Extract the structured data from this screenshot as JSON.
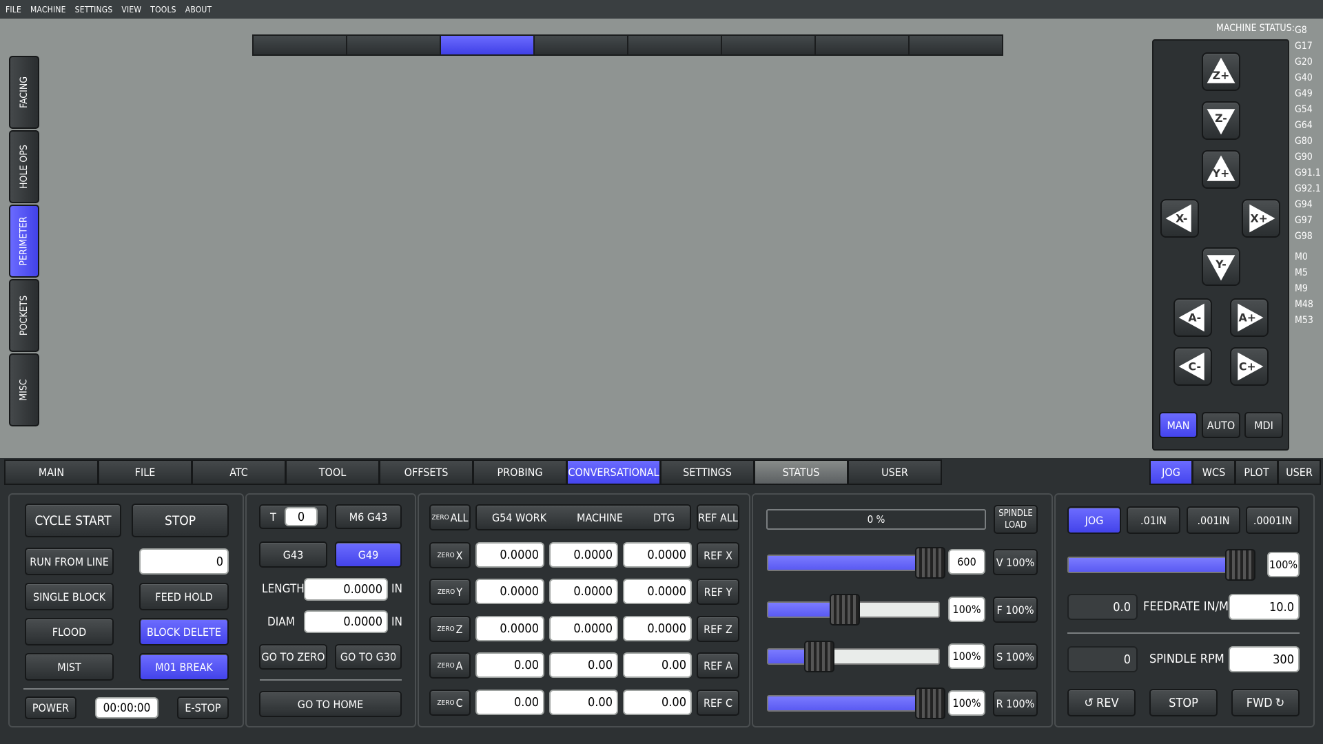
{
  "menu": [
    "FILE",
    "MACHINE",
    "SETTINGS",
    "VIEW",
    "TOOLS",
    "ABOUT"
  ],
  "side_tabs": [
    {
      "label": "FACING",
      "active": false
    },
    {
      "label": "HOLE OPS",
      "active": false
    },
    {
      "label": "PERIMETER",
      "active": true
    },
    {
      "label": "POCKETS",
      "active": false
    },
    {
      "label": "MISC",
      "active": false
    }
  ],
  "conv_strip_active_index": 2,
  "machine_status": {
    "title": "MACHINE STATUS:",
    "gcodes": [
      "G8",
      "G17",
      "G20",
      "G40",
      "G49",
      "G54",
      "G64",
      "G80",
      "G90",
      "G91.1",
      "G92.1",
      "G94",
      "G97",
      "G98"
    ],
    "mcodes": [
      "M0",
      "M5",
      "M9",
      "M48",
      "M53"
    ]
  },
  "jog_buttons": [
    "Z+",
    "Z-",
    "Y+",
    "X-",
    "X+",
    "Y-",
    "A-",
    "A+",
    "C-",
    "C+"
  ],
  "modes": [
    "MAN",
    "AUTO",
    "MDI"
  ],
  "main_tabs": [
    "MAIN",
    "FILE",
    "ATC",
    "TOOL",
    "OFFSETS",
    "PROBING",
    "CONVERSATIONAL",
    "SETTINGS",
    "STATUS",
    "USER"
  ],
  "right_tabs": [
    "JOG",
    "WCS",
    "PLOT",
    "USER"
  ],
  "program": {
    "cycle_start": "CYCLE START",
    "stop": "STOP",
    "run_from_line": "RUN FROM LINE",
    "run_line_value": "0",
    "single_block": "SINGLE BLOCK",
    "feed_hold": "FEED HOLD",
    "flood": "FLOOD",
    "block_delete": "BLOCK DELETE",
    "mist": "MIST",
    "m01_break": "M01 BREAK",
    "power": "POWER",
    "timer": "00:00:00",
    "estop": "E-STOP"
  },
  "tool": {
    "t_label": "T",
    "t_value": "0",
    "m6g43": "M6 G43",
    "g43": "G43",
    "g49": "G49",
    "length_label": "LENGTH",
    "length_value": "0.0000",
    "diam_label": "DIAM",
    "diam_value": "0.0000",
    "unit": "IN",
    "go_to_zero": "GO TO ZERO",
    "go_to_g30": "GO TO G30",
    "go_to_home": "GO TO HOME"
  },
  "dro": {
    "zero_all_small": "ZERO",
    "zero_all": "ALL",
    "ref_all": "REF ALL",
    "headers": [
      "G54 WORK",
      "MACHINE",
      "DTG"
    ],
    "rows": [
      {
        "axis": "X",
        "values": [
          "0.0000",
          "0.0000",
          "0.0000"
        ],
        "ref": "REF X"
      },
      {
        "axis": "Y",
        "values": [
          "0.0000",
          "0.0000",
          "0.0000"
        ],
        "ref": "REF Y"
      },
      {
        "axis": "Z",
        "values": [
          "0.0000",
          "0.0000",
          "0.0000"
        ],
        "ref": "REF Z"
      },
      {
        "axis": "A",
        "values": [
          "0.00",
          "0.00",
          "0.00"
        ],
        "ref": "REF A"
      },
      {
        "axis": "C",
        "values": [
          "0.00",
          "0.00",
          "0.00"
        ],
        "ref": "REF C"
      }
    ]
  },
  "overrides": {
    "load_text": "0 %",
    "spindle_load_1": "SPINDLE",
    "spindle_load_2": "LOAD",
    "rows": [
      {
        "value": "600",
        "button": "V 100%",
        "fill": 0.95
      },
      {
        "value": "100%",
        "button": "F 100%",
        "fill": 0.45
      },
      {
        "value": "100%",
        "button": "S 100%",
        "fill": 0.3
      },
      {
        "value": "100%",
        "button": "R 100%",
        "fill": 0.95
      }
    ]
  },
  "jog_panel": {
    "jog": "JOG",
    "inc1": ".01IN",
    "inc2": ".001IN",
    "inc3": ".0001IN",
    "jog_rate": "100%",
    "jog_fill": 0.93,
    "feed_actual": "0.0",
    "feed_label": "FEEDRATE IN/M",
    "feed_value": "10.0",
    "rpm_actual": "0",
    "rpm_label": "SPINDLE RPM",
    "rpm_value": "300",
    "rev": "REV",
    "stop": "STOP",
    "fwd": "FWD"
  },
  "colors": {
    "accent": "#5555f5",
    "panel": "#2d3133",
    "preview": "#8f9492"
  }
}
